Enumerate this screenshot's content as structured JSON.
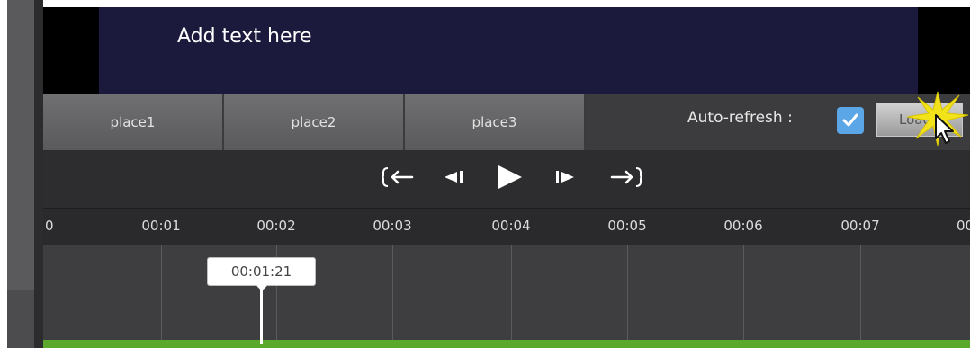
{
  "preview": {
    "text": "Add text here",
    "canvas_color": "#1c1a3c"
  },
  "tabs": [
    {
      "label": "place1"
    },
    {
      "label": "place2"
    },
    {
      "label": "place3"
    }
  ],
  "toolbar": {
    "auto_refresh_label": "Auto-refresh :",
    "auto_refresh_checked": true,
    "load_button_label": "Load"
  },
  "transport": {
    "buttons": [
      {
        "icon": "go-to-start-icon"
      },
      {
        "icon": "step-back-icon"
      },
      {
        "icon": "play-icon"
      },
      {
        "icon": "step-forward-icon"
      },
      {
        "icon": "go-to-end-icon"
      }
    ]
  },
  "ruler": {
    "labels": [
      "0",
      "00:01",
      "00:02",
      "00:03",
      "00:04",
      "00:05",
      "00:06",
      "00:07",
      "00"
    ]
  },
  "playhead": {
    "timecode": "00:01:21"
  },
  "colors": {
    "accent_checkbox": "#5aa6e6",
    "track_green": "#5aa82c",
    "background": "#3a3a3c"
  }
}
